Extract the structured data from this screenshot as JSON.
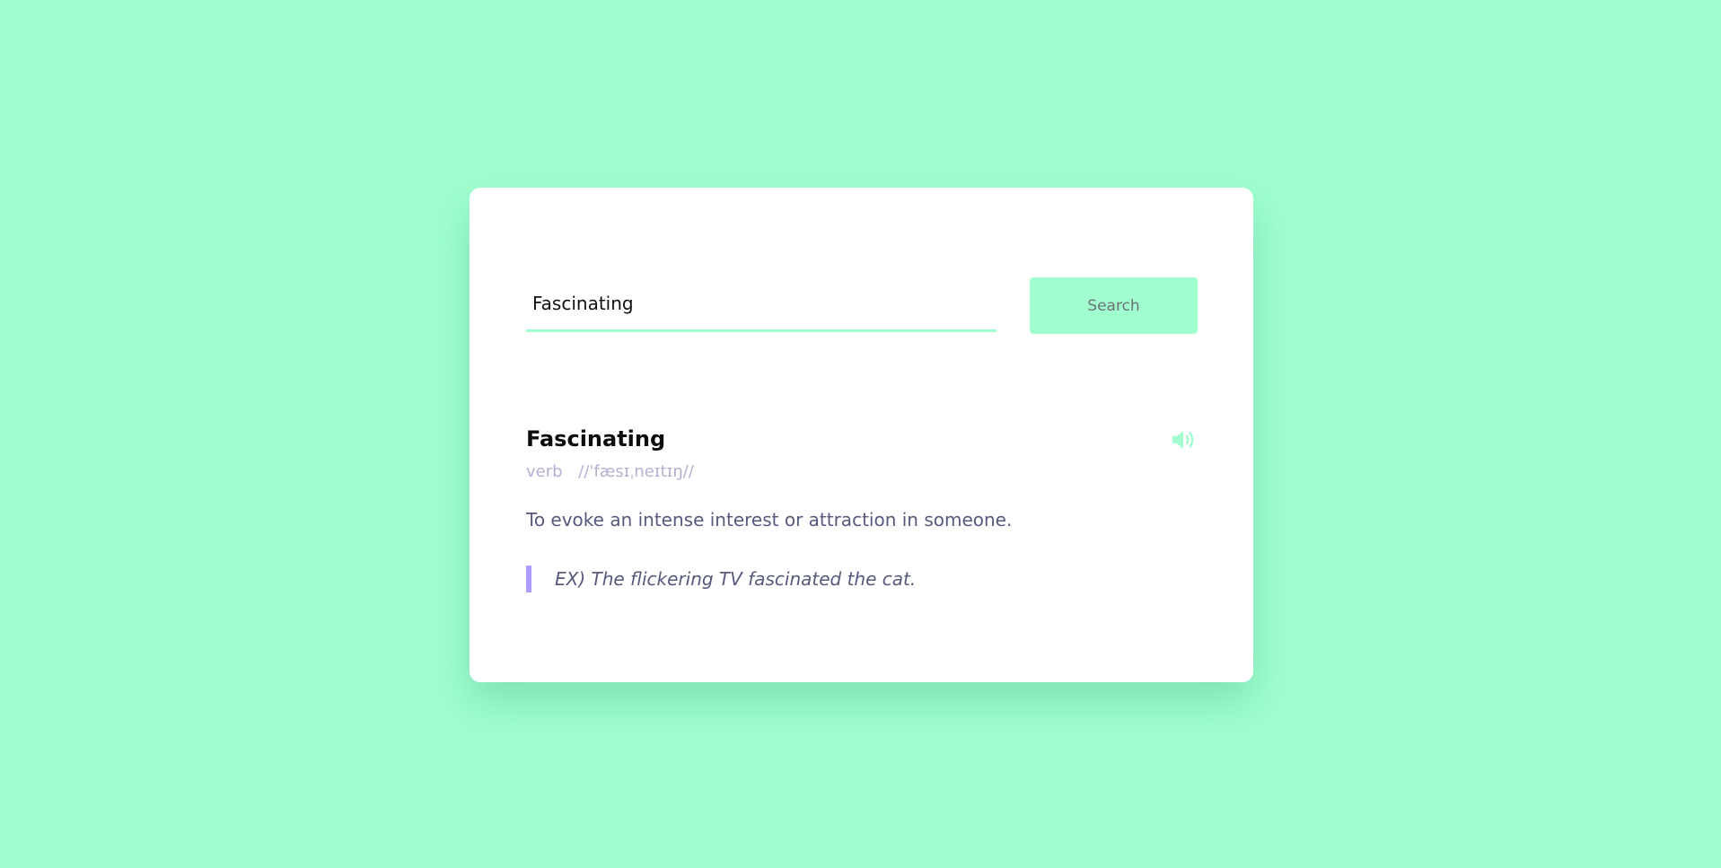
{
  "search": {
    "value": "Fascinating",
    "button_label": "Search"
  },
  "result": {
    "word": "Fascinating",
    "part_of_speech": "verb",
    "phonetic": "//ˈfæsɪˌneɪtɪŋ//",
    "meaning": "To evoke an intense interest or attraction in someone.",
    "example": "EX) The flickering TV fascinated the cat.",
    "speaker_icon": "volume-up-icon"
  },
  "colors": {
    "background": "#a0fecf",
    "accent": "#a0fecf",
    "example_bar": "#ad9cff",
    "details": "#b5b1d4",
    "text": "#575a7c"
  }
}
